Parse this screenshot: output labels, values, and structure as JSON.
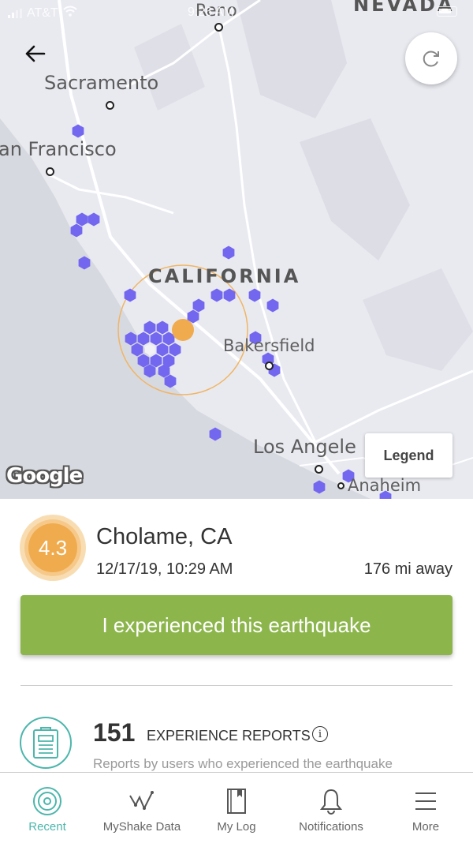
{
  "status_bar": {
    "carrier": "AT&T",
    "time": "9:26 AM"
  },
  "map": {
    "labels": {
      "reno": "Reno",
      "nevada": "NEVADA",
      "sacramento": "Sacramento",
      "san_francisco": "an Francisco",
      "california": "CALIFORNIA",
      "bakersfield": "Bakersfield",
      "los_angeles": "Los Angele",
      "anaheim": "Anaheim"
    },
    "legend_label": "Legend",
    "attribution": "Google",
    "report_hex_color": "#7367f0",
    "epicenter_color": "#f0ab4e"
  },
  "event": {
    "magnitude": "4.3",
    "location": "Cholame, CA",
    "datetime": "12/17/19, 10:29 AM",
    "distance": "176 mi away",
    "experienced_button": "I experienced this earthquake",
    "magnitude_color": "#f0ab4e",
    "button_color": "#8cb54b"
  },
  "reports": {
    "count": "151",
    "label": "EXPERIENCE REPORTS",
    "description": "Reports by users who experienced the earthquake"
  },
  "tabs": [
    {
      "label": "Recent",
      "icon": "target-icon",
      "active": true
    },
    {
      "label": "MyShake Data",
      "icon": "seismograph-icon",
      "active": false
    },
    {
      "label": "My Log",
      "icon": "book-icon",
      "active": false
    },
    {
      "label": "Notifications",
      "icon": "bell-icon",
      "active": false
    },
    {
      "label": "More",
      "icon": "menu-icon",
      "active": false
    }
  ],
  "accent_color": "#4db6ac"
}
